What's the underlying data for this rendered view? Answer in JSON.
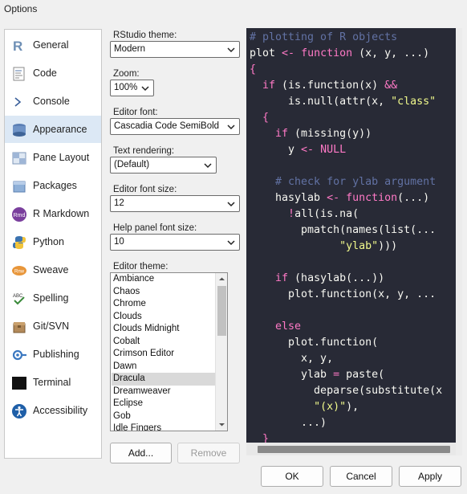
{
  "window": {
    "title": "Options"
  },
  "sidebar": {
    "items": [
      {
        "label": "General",
        "icon": "r-logo-icon"
      },
      {
        "label": "Code",
        "icon": "code-icon"
      },
      {
        "label": "Console",
        "icon": "console-icon"
      },
      {
        "label": "Appearance",
        "icon": "appearance-icon",
        "selected": true
      },
      {
        "label": "Pane Layout",
        "icon": "pane-layout-icon"
      },
      {
        "label": "Packages",
        "icon": "packages-icon"
      },
      {
        "label": "R Markdown",
        "icon": "rmarkdown-icon",
        "icon_text": "Rmd"
      },
      {
        "label": "Python",
        "icon": "python-icon"
      },
      {
        "label": "Sweave",
        "icon": "sweave-icon"
      },
      {
        "label": "Spelling",
        "icon": "spelling-icon",
        "icon_text": "ABC"
      },
      {
        "label": "Git/SVN",
        "icon": "git-svn-icon"
      },
      {
        "label": "Publishing",
        "icon": "publishing-icon"
      },
      {
        "label": "Terminal",
        "icon": "terminal-icon"
      },
      {
        "label": "Accessibility",
        "icon": "accessibility-icon"
      }
    ]
  },
  "form": {
    "rstudio_theme": {
      "label": "RStudio theme:",
      "value": "Modern"
    },
    "zoom": {
      "label": "Zoom:",
      "value": "100%"
    },
    "editor_font": {
      "label": "Editor font:",
      "value": "Cascadia Code SemiBold"
    },
    "text_rendering": {
      "label": "Text rendering:",
      "value": "(Default)"
    },
    "editor_font_size": {
      "label": "Editor font size:",
      "value": "12"
    },
    "help_font_size": {
      "label": "Help panel font size:",
      "value": "10"
    },
    "editor_theme": {
      "label": "Editor theme:",
      "selected": "Dracula",
      "options": [
        "Ambiance",
        "Chaos",
        "Chrome",
        "Clouds",
        "Clouds Midnight",
        "Cobalt",
        "Crimson Editor",
        "Dawn",
        "Dracula",
        "Dreamweaver",
        "Eclipse",
        "Gob",
        "Idle Fingers"
      ]
    },
    "add_label": "Add...",
    "remove_label": "Remove"
  },
  "preview": {
    "lines": [
      [
        {
          "t": "# plotting of R objects",
          "c": "com"
        }
      ],
      [
        {
          "t": "plot ",
          "c": "txt"
        },
        {
          "t": "<-",
          "c": "kw"
        },
        {
          "t": " ",
          "c": "txt"
        },
        {
          "t": "function",
          "c": "kw"
        },
        {
          "t": " (x, y, ...)",
          "c": "txt"
        }
      ],
      [
        {
          "t": "{",
          "c": "kw"
        }
      ],
      [
        {
          "t": "  ",
          "c": "txt"
        },
        {
          "t": "if",
          "c": "kw"
        },
        {
          "t": " (is.function(x) ",
          "c": "txt"
        },
        {
          "t": "&&",
          "c": "kw"
        }
      ],
      [
        {
          "t": "      is.null(attr(x, ",
          "c": "txt"
        },
        {
          "t": "\"class\"",
          "c": "str"
        }
      ],
      [
        {
          "t": "  ",
          "c": "txt"
        },
        {
          "t": "{",
          "c": "kw"
        }
      ],
      [
        {
          "t": "    ",
          "c": "txt"
        },
        {
          "t": "if",
          "c": "kw"
        },
        {
          "t": " (missing(y))",
          "c": "txt"
        }
      ],
      [
        {
          "t": "      y ",
          "c": "txt"
        },
        {
          "t": "<-",
          "c": "kw"
        },
        {
          "t": " ",
          "c": "txt"
        },
        {
          "t": "NULL",
          "c": "kw"
        }
      ],
      [
        {
          "t": "",
          "c": "txt"
        }
      ],
      [
        {
          "t": "    # check for ylab argument",
          "c": "com"
        }
      ],
      [
        {
          "t": "    hasylab ",
          "c": "txt"
        },
        {
          "t": "<-",
          "c": "kw"
        },
        {
          "t": " ",
          "c": "txt"
        },
        {
          "t": "function",
          "c": "kw"
        },
        {
          "t": "(...)",
          "c": "txt"
        }
      ],
      [
        {
          "t": "      ",
          "c": "txt"
        },
        {
          "t": "!",
          "c": "kw"
        },
        {
          "t": "all(is.na(",
          "c": "txt"
        }
      ],
      [
        {
          "t": "        pmatch(names(list(...",
          "c": "txt"
        }
      ],
      [
        {
          "t": "              ",
          "c": "txt"
        },
        {
          "t": "\"ylab\"",
          "c": "str"
        },
        {
          "t": ")))",
          "c": "txt"
        }
      ],
      [
        {
          "t": "",
          "c": "txt"
        }
      ],
      [
        {
          "t": "    ",
          "c": "txt"
        },
        {
          "t": "if",
          "c": "kw"
        },
        {
          "t": " (hasylab(...))",
          "c": "txt"
        }
      ],
      [
        {
          "t": "      plot.function(x, y, ...",
          "c": "txt"
        }
      ],
      [
        {
          "t": "",
          "c": "txt"
        }
      ],
      [
        {
          "t": "    ",
          "c": "txt"
        },
        {
          "t": "else",
          "c": "kw"
        }
      ],
      [
        {
          "t": "      plot.function(",
          "c": "txt"
        }
      ],
      [
        {
          "t": "        x, y,",
          "c": "txt"
        }
      ],
      [
        {
          "t": "        ylab ",
          "c": "txt"
        },
        {
          "t": "=",
          "c": "kw"
        },
        {
          "t": " paste(",
          "c": "txt"
        }
      ],
      [
        {
          "t": "          deparse(substitute(x",
          "c": "txt"
        }
      ],
      [
        {
          "t": "          ",
          "c": "txt"
        },
        {
          "t": "\"(x)\"",
          "c": "str"
        },
        {
          "t": "),",
          "c": "txt"
        }
      ],
      [
        {
          "t": "        ...)",
          "c": "txt"
        }
      ],
      [
        {
          "t": "  ",
          "c": "txt"
        },
        {
          "t": "}",
          "c": "kw"
        }
      ]
    ]
  },
  "footer": {
    "ok_label": "OK",
    "cancel_label": "Cancel",
    "apply_label": "Apply"
  }
}
